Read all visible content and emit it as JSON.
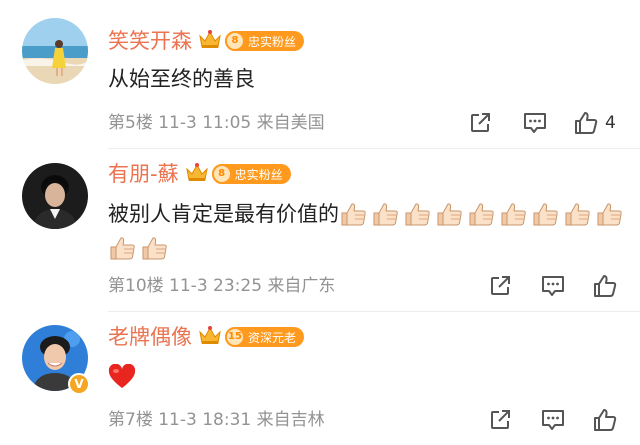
{
  "comments": [
    {
      "name": "笑笑开森",
      "badge_level": "8",
      "badge_text": "忠实粉丝",
      "text": "从始至终的善良",
      "floor": "第5楼",
      "time": "11-3 11:05",
      "location": "来自美国",
      "like_count": "4"
    },
    {
      "name": "有朋-蘇",
      "badge_level": "8",
      "badge_text": "忠实粉丝",
      "text": "被别人肯定是最有价值的",
      "emoji_count": 11,
      "floor": "第10楼",
      "time": "11-3 23:25",
      "location": "来自广东"
    },
    {
      "name": "老牌偶像",
      "badge_level": "15",
      "badge_text": "资深元老",
      "verified_mark": "V",
      "emoji": "heart",
      "floor": "第7楼",
      "time": "11-3 18:31",
      "location": "来自吉林"
    }
  ],
  "colors": {
    "name": "#eb7350",
    "meta": "#939393",
    "badge": "#ff9a1f",
    "heart": "#e8251f"
  },
  "icons": [
    "crown-icon",
    "share-icon",
    "comment-icon",
    "like-icon",
    "thumbs-up-emoji"
  ]
}
